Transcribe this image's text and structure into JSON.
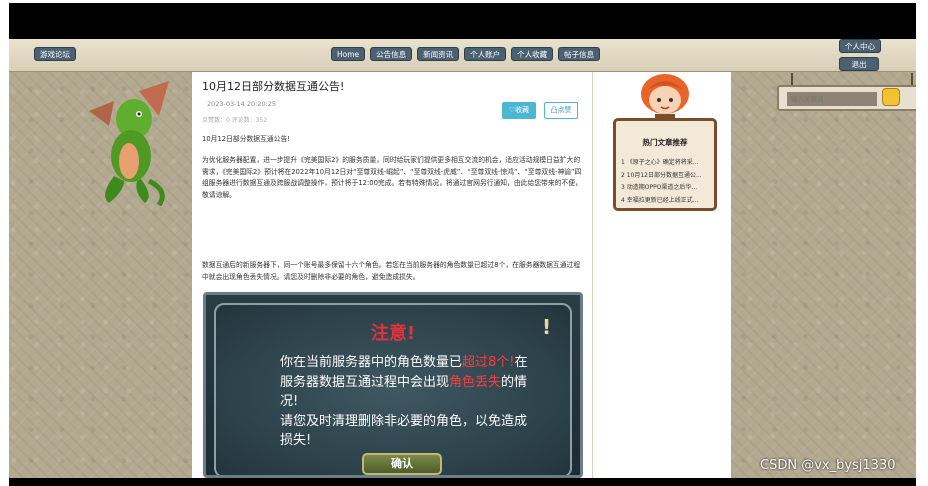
{
  "nav": {
    "game_forum": "游戏论坛",
    "links": [
      "Home",
      "公告信息",
      "新闻资讯",
      "个人账户",
      "个人收藏",
      "帖子信息"
    ],
    "personal_center": "个人中心",
    "logout": "退出"
  },
  "article": {
    "title": "10月12日部分数据互通公告!",
    "date": "2023-03-14 20:20:25",
    "stats": "点赞数：0    评论数：352",
    "fav_label": "♡收藏",
    "like_label": "凸点赞",
    "p1": "10月12日部分数据互通公告!",
    "p2": "为优化服务器配置，进一步提升《完美国际2》的服务质量，同时给玩家们提供更多相互交流的机会，适应活动规模日益扩大的需求，《完美国际2》预计将在2022年10月12日对“至尊双线-崛起”、“至尊双线-虎威”、“至尊双线-惊鸿”、“至尊双线-神谕”四组服务器进行数据互通及跨服战调整操作，预计将于12:00完成。若有特殊情况，将通过官网另行通知，由此给您带来的不便，敬请谅解。",
    "p3": "数据互通后的新服务器下，同一个账号最多保留十六个角色。若您在当前服务器的角色数量已超过8个，在服务器数据互通过程中就会出现角色丢失情况。请您及时删除非必要的角色，避免造成损失。"
  },
  "notice": {
    "title": "注意!",
    "excl": "!",
    "line_a": "你在当前服务器中的角色数量已",
    "red_a": "超过8个!",
    "line_b": "在服务器数据互通过程中会出现",
    "red_b": "角色丢失",
    "line_c": "的情况!",
    "line_d": "请您及时清理删除非必要的角色，以免造成损失!",
    "confirm": "确认"
  },
  "hot": {
    "title": "热门文章推荐",
    "items": [
      "1 《原子之心》确定将将采...",
      "2 10月12日部分数据互通公...",
      "3 动造期OPPO渠道之后华...",
      "4 幸福拉更新已经上线正式..."
    ]
  },
  "search": {
    "placeholder": "输入关键词"
  },
  "watermark": "CSDN @vx_bysj1330"
}
